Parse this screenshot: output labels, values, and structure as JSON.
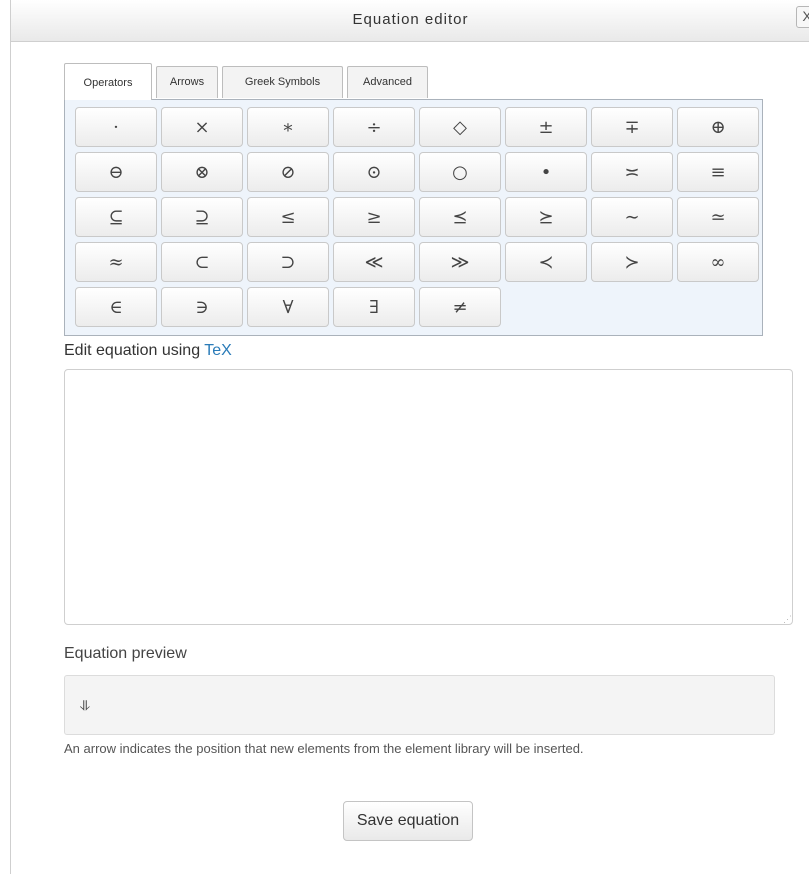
{
  "dialog": {
    "title": "Equation editor",
    "close_label": "X"
  },
  "tabs": [
    {
      "label": "Operators",
      "active": true
    },
    {
      "label": "Arrows",
      "active": false
    },
    {
      "label": "Greek Symbols",
      "active": false
    },
    {
      "label": "Advanced",
      "active": false
    }
  ],
  "symbols": [
    [
      "·",
      "×",
      "∗",
      "÷",
      "◇",
      "±",
      "∓",
      "⊕"
    ],
    [
      "⊖",
      "⊗",
      "⊘",
      "⊙",
      "○",
      "•",
      "≍",
      "≡"
    ],
    [
      "⊆",
      "⊇",
      "≤",
      "≥",
      "⪯",
      "⪰",
      "∼",
      "≃"
    ],
    [
      "≈",
      "⊂",
      "⊃",
      "≪",
      "≫",
      "≺",
      "≻",
      "∞"
    ],
    [
      "∈",
      "∋",
      "∀",
      "∃",
      "≠"
    ]
  ],
  "editor": {
    "label_prefix": "Edit equation using ",
    "label_link": "TeX",
    "value": ""
  },
  "preview": {
    "label": "Equation preview",
    "content": "⥥"
  },
  "hint": "An arrow indicates the position that new elements from the element library will be inserted.",
  "save_label": "Save equation"
}
